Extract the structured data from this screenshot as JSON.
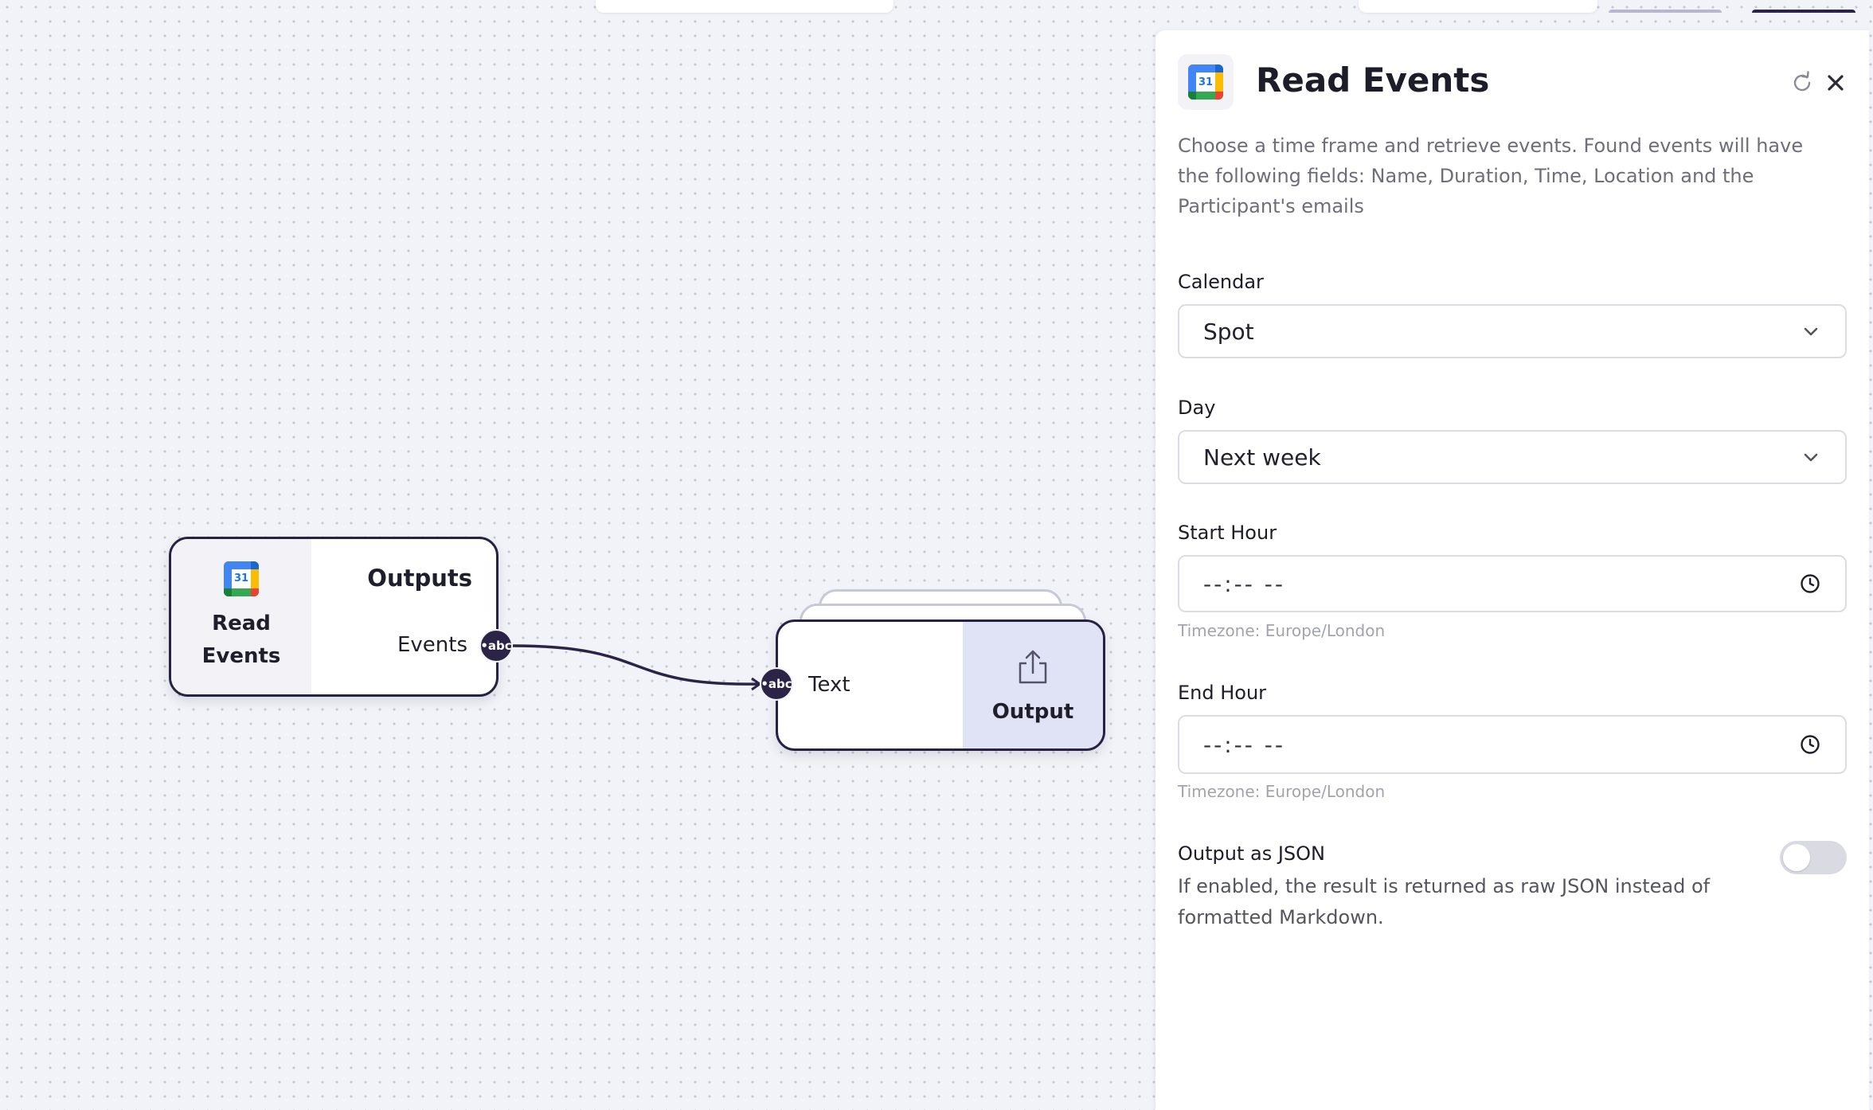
{
  "canvas": {
    "nodes": {
      "read_events": {
        "title": "Read Events",
        "outputs_heading": "Outputs",
        "output_port_label": "Events",
        "port_type_badge": "abc",
        "icon": "google-calendar-icon",
        "icon_day": "31"
      },
      "output": {
        "title": "Output",
        "input_port_label": "Text",
        "port_type_badge": "abc",
        "icon": "share-upload-icon"
      }
    }
  },
  "panel": {
    "title": "Read Events",
    "icon": "google-calendar-icon",
    "icon_day": "31",
    "description": "Choose a time frame and retrieve events. Found events will have the following fields: Name, Duration, Time, Location and the Participant's emails",
    "fields": {
      "calendar": {
        "label": "Calendar",
        "value": "Spot"
      },
      "day": {
        "label": "Day",
        "value": "Next week"
      },
      "start_hour": {
        "label": "Start Hour",
        "value": "--:-- --",
        "hint": "Timezone: Europe/London"
      },
      "end_hour": {
        "label": "End Hour",
        "value": "--:-- --",
        "hint": "Timezone: Europe/London"
      }
    },
    "output_json": {
      "label": "Output as JSON",
      "enabled": false,
      "description": "If enabled, the result is returned as raw JSON instead of formatted Markdown."
    }
  },
  "colors": {
    "node_border": "#262240",
    "port_fill": "#2b2447",
    "output_node_accent": "#dfe3f5",
    "canvas_bg": "#f1f3f8"
  }
}
